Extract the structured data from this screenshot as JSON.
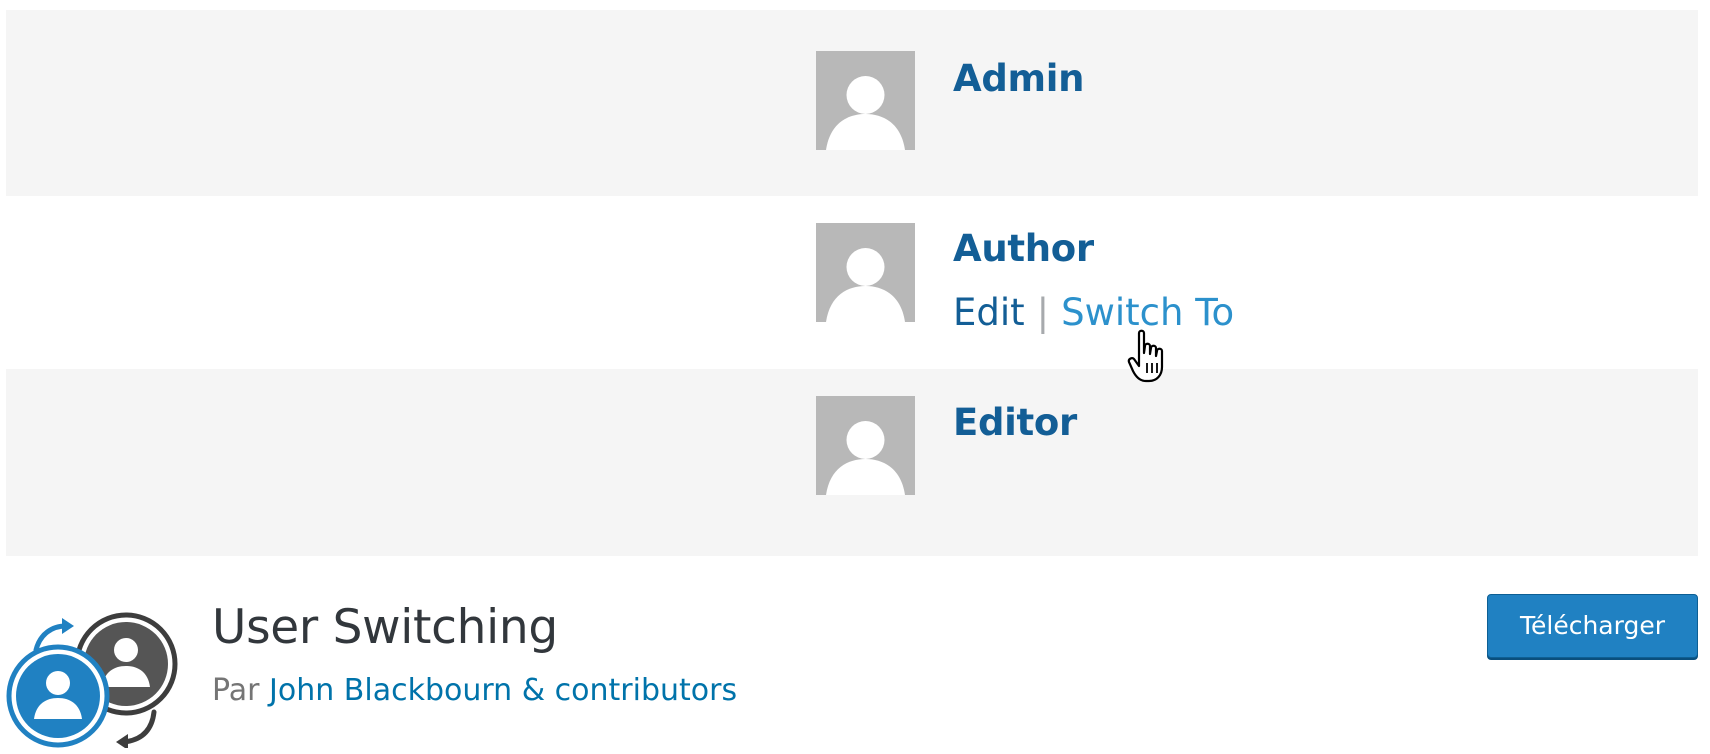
{
  "users": [
    {
      "name": "Admin"
    },
    {
      "name": "Author",
      "actions": {
        "edit": "Edit",
        "separator": "|",
        "switch_to": "Switch To"
      }
    },
    {
      "name": "Editor"
    }
  ],
  "plugin": {
    "title": "User Switching",
    "by_label": "Par",
    "author": "John Blackbourn & contributors",
    "download_label": "Télécharger",
    "icon": "user-switching-icon"
  },
  "colors": {
    "link": "#135e96",
    "hover_link": "#2c91cc",
    "button": "#2081c2",
    "row_alt": "#f5f5f5",
    "avatar": "#b8b8b8"
  }
}
